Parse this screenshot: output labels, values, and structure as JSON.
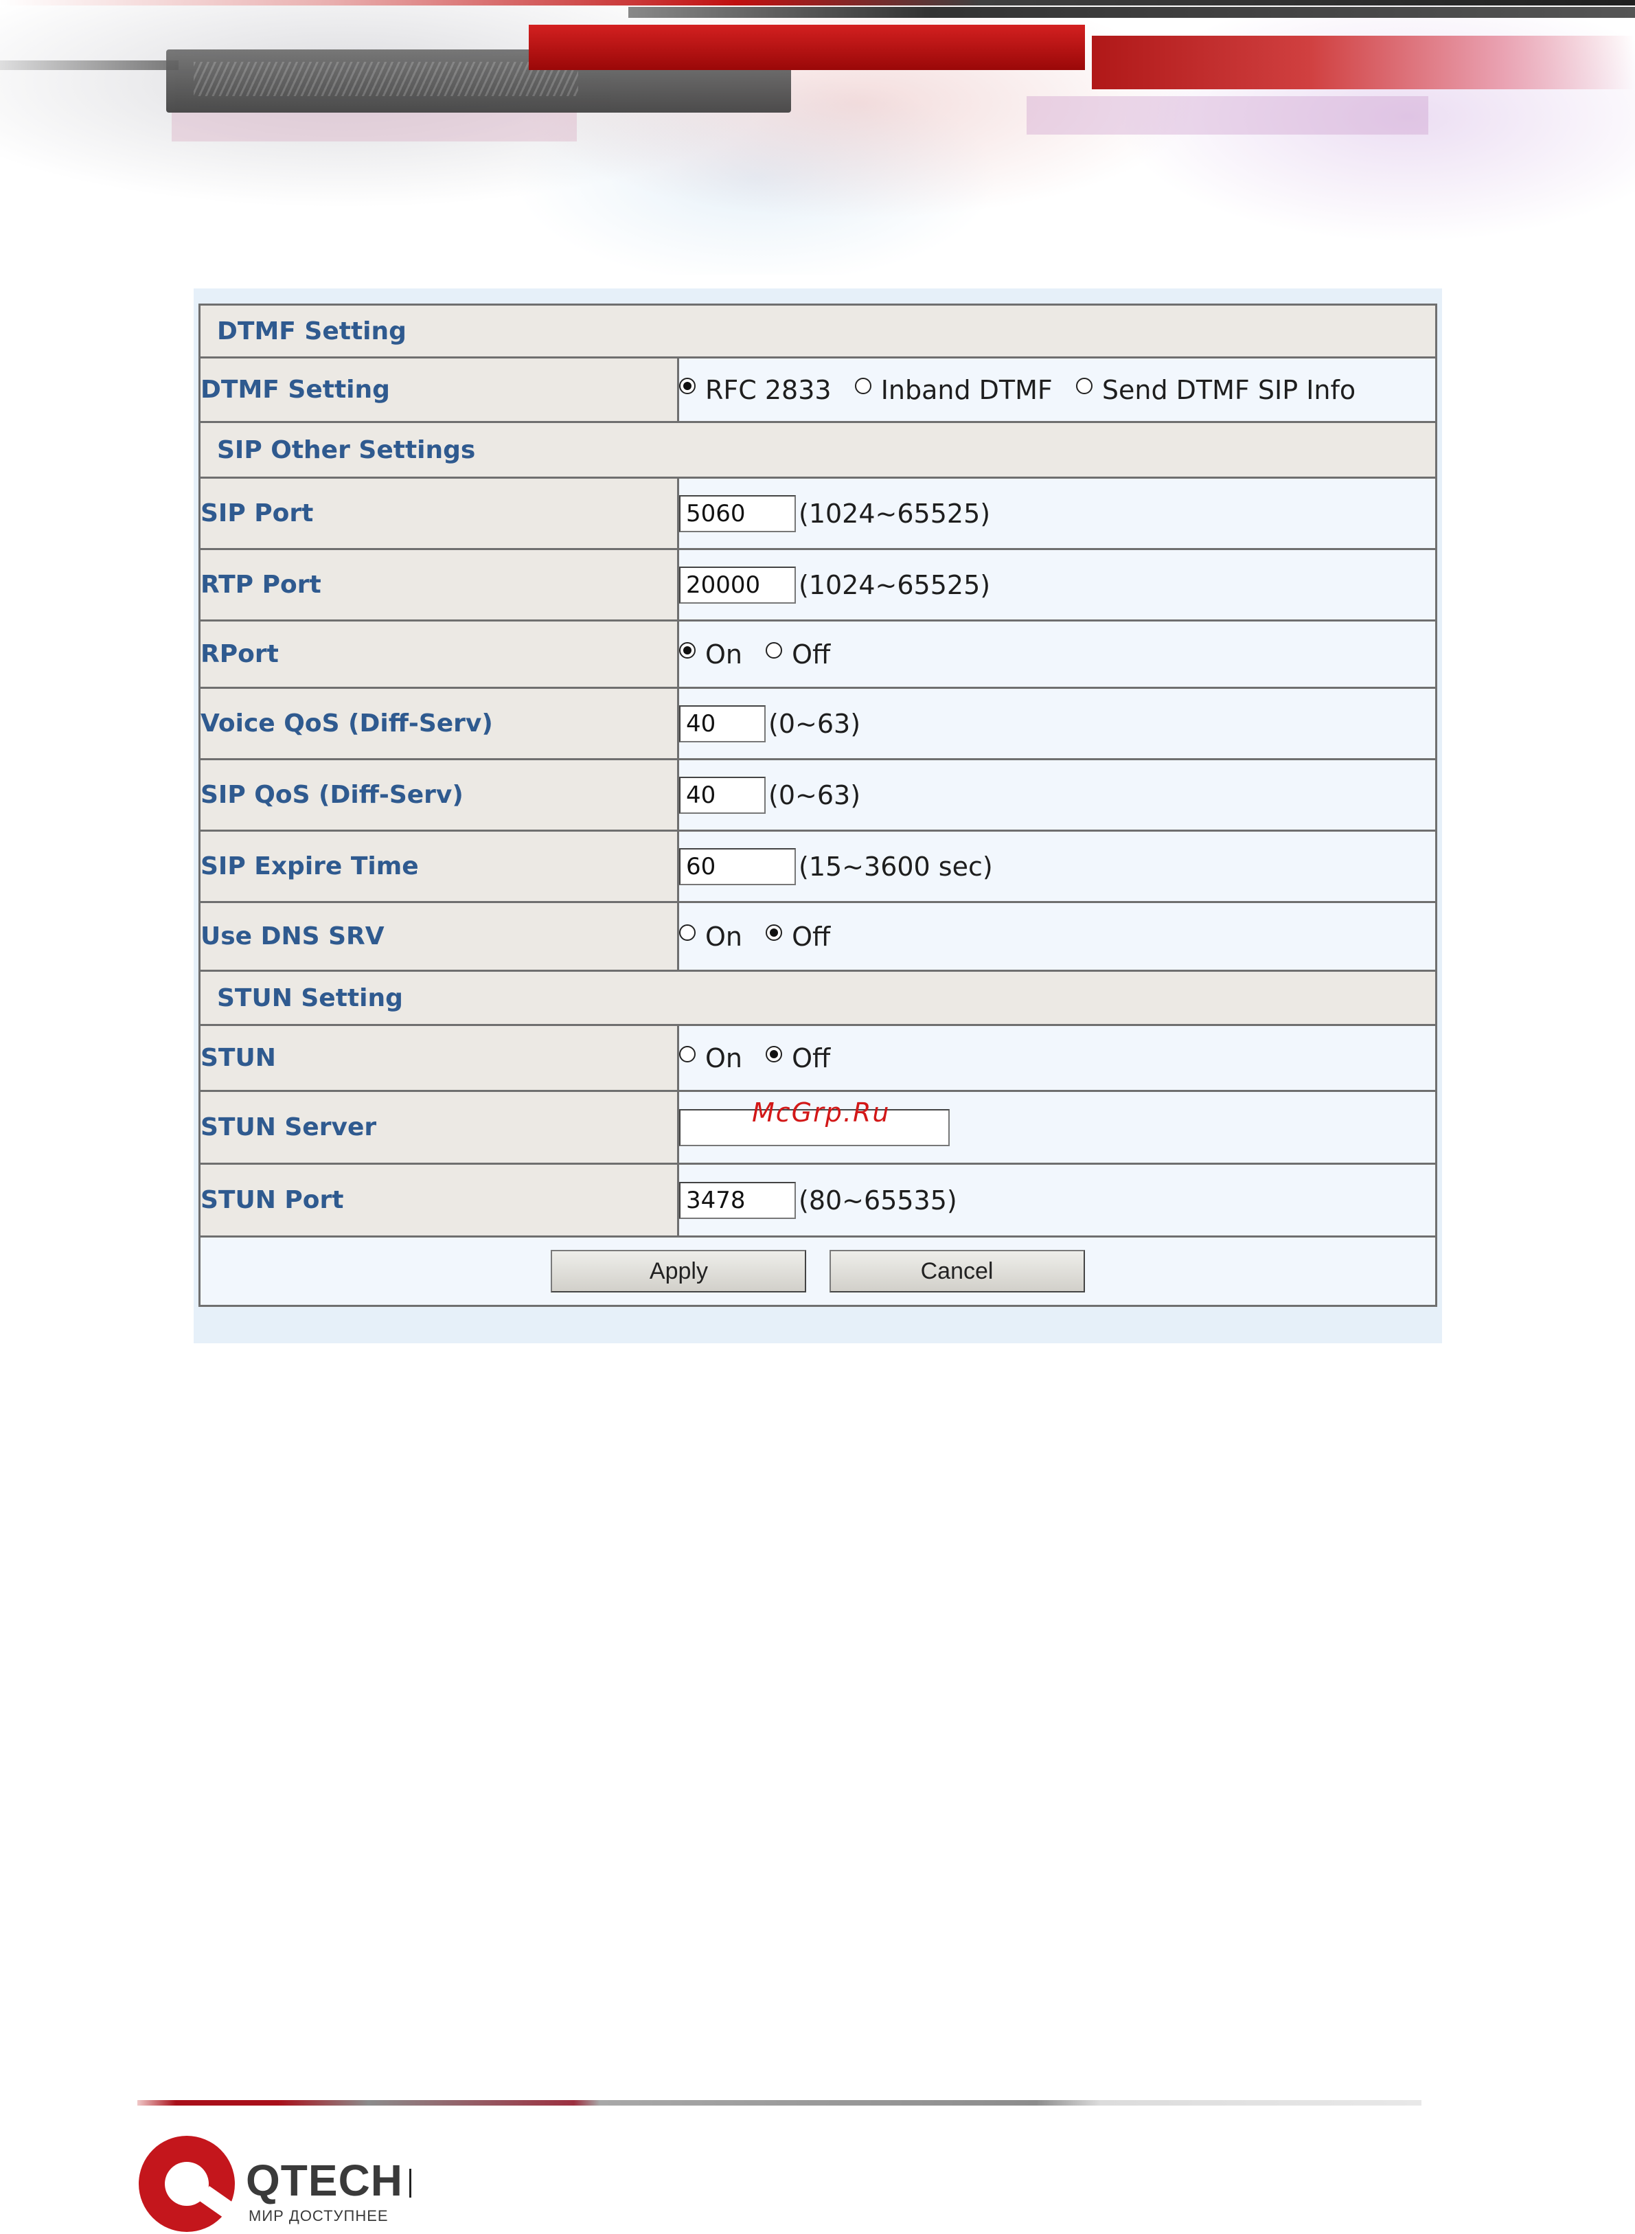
{
  "sections": {
    "dtmf": "DTMF Setting",
    "sip_other": "SIP Other Settings",
    "stun": "STUN Setting"
  },
  "dtmf_setting": {
    "label": "DTMF Setting",
    "options": [
      "RFC 2833",
      "Inband DTMF",
      "Send DTMF SIP Info"
    ],
    "selected": "RFC 2833"
  },
  "sip_port": {
    "label": "SIP Port",
    "value": "5060",
    "range": "(1024~65525)"
  },
  "rtp_port": {
    "label": "RTP Port",
    "value": "20000",
    "range": "(1024~65525)"
  },
  "rport": {
    "label": "RPort",
    "on": "On",
    "off": "Off",
    "selected": "On"
  },
  "voice_qos": {
    "label": "Voice QoS (Diff-Serv)",
    "value": "40",
    "range": "(0~63)"
  },
  "sip_qos": {
    "label": "SIP QoS (Diff-Serv)",
    "value": "40",
    "range": "(0~63)"
  },
  "sip_expire": {
    "label": "SIP Expire Time",
    "value": "60",
    "range": "(15~3600 sec)"
  },
  "dns_srv": {
    "label": "Use DNS SRV",
    "on": "On",
    "off": "Off",
    "selected": "Off"
  },
  "stun_toggle": {
    "label": "STUN",
    "on": "On",
    "off": "Off",
    "selected": "Off"
  },
  "stun_server": {
    "label": "STUN Server",
    "value": ""
  },
  "stun_port": {
    "label": "STUN Port",
    "value": "3478",
    "range": "(80~65535)"
  },
  "buttons": {
    "apply": "Apply",
    "cancel": "Cancel"
  },
  "watermark": "McGrp.Ru",
  "footer": {
    "brand": "QTECH",
    "tagline": "МИР ДОСТУПНЕЕ"
  },
  "colors": {
    "label_text": "#2f5a8f",
    "accent_red": "#c4161c",
    "panel_bg": "#e6f0f9"
  }
}
